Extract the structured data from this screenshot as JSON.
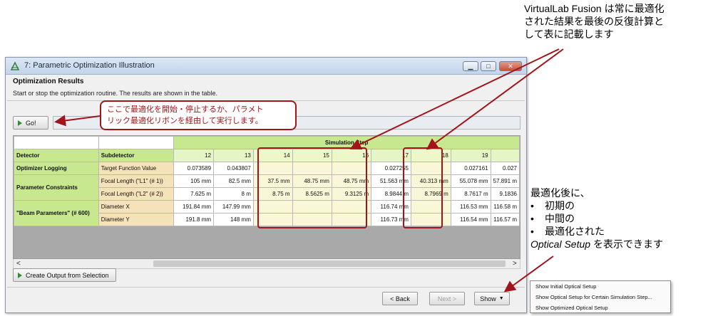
{
  "window": {
    "title": "7: Parametric Optimization Illustration",
    "minimize_glyph": "▁",
    "maximize_glyph": "□",
    "close_glyph": "✕"
  },
  "section": {
    "heading": "Optimization Results",
    "description": "Start or stop the optimization routine. The results are shown in the table."
  },
  "go_button": "Go!",
  "table": {
    "group_header": "Simulation Step",
    "headers": [
      "Detector",
      "Subdetector"
    ],
    "steps": [
      "12",
      "13",
      "14",
      "15",
      "16",
      "17",
      "18",
      "19",
      ""
    ],
    "rows": [
      {
        "detector": "Optimizer Logging",
        "sub": "Target Function Value",
        "cells": [
          "0.073589",
          "0.043807",
          "",
          "",
          "",
          "0.027255",
          "",
          "0.027161",
          "0.027"
        ]
      },
      {
        "detector": "Parameter Constraints",
        "sub": "Focal Length (\"L1\" (# 1))",
        "cells": [
          "105 mm",
          "82.5 mm",
          "37.5 mm",
          "48.75 mm",
          "48.75 mm",
          "51.563 mm",
          "40.313 mm",
          "55.078 mm",
          "57.891 m"
        ]
      },
      {
        "detector": "",
        "sub": "Focal Length (\"L2\" (# 2))",
        "cells": [
          "7.625 m",
          "8 m",
          "8.75 m",
          "8.5625 m",
          "9.3125 m",
          "8.9844 m",
          "8.7969 m",
          "8.7617 m",
          "9.1836"
        ]
      },
      {
        "detector": "\"Beam Parameters\" (# 600)",
        "sub": "Diameter X",
        "cells": [
          "191.84 mm",
          "147.99 mm",
          "",
          "",
          "",
          "116.74 mm",
          "",
          "116.53 mm",
          "116.58 m"
        ]
      },
      {
        "detector": "",
        "sub": "Diameter Y",
        "cells": [
          "191.8 mm",
          "148 mm",
          "",
          "",
          "",
          "116.73 mm",
          "",
          "116.54 mm",
          "116.57 m"
        ]
      }
    ]
  },
  "scroll": {
    "left": "<",
    "right": ">"
  },
  "create_output_button": "Create Output from Selection",
  "footer": {
    "back": "< Back",
    "next": "Next >",
    "show": "Show"
  },
  "show_menu": [
    "Show Initial Optical Setup",
    "Show Optical Setup for Certain Simulation Step...",
    "Show Optimized Optical Setup"
  ],
  "callout": {
    "line1": "ここで最適化を開始・停止するか、パラメト",
    "line2": "リック最適化リボンを経由して実行します。"
  },
  "note_top": {
    "line1": "VirtualLab Fusion は常に最適化",
    "line2": "された結果を最後の反復計算と",
    "line3": "して表に記載します"
  },
  "note_right": {
    "line1": "最適化後に、",
    "items": [
      "初期の",
      "中間の",
      "最適化された"
    ],
    "last_em": "Optical Setup",
    "last_rest": " を表示できます"
  },
  "colors": {
    "accent_red": "#a2141a",
    "header_green": "#c7e88f",
    "sub_orange": "#f6e2b8",
    "highlight": "#f9f7d8"
  }
}
